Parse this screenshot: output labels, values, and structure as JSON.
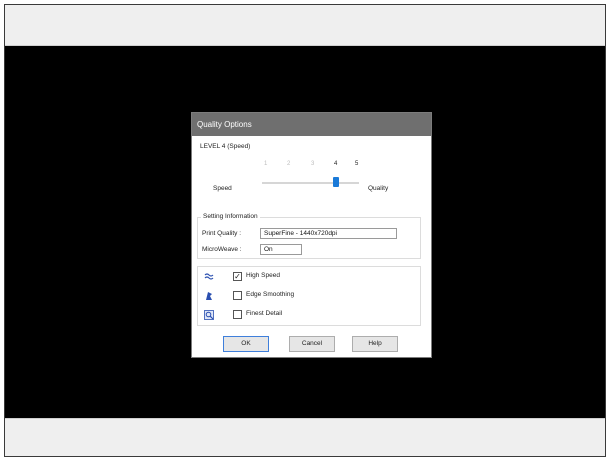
{
  "dialog": {
    "title": "Quality Options",
    "level_label": "LEVEL 4 (Speed)",
    "slider": {
      "ticks": [
        "1",
        "2",
        "3",
        "4",
        "5"
      ],
      "selected": 4,
      "left_label": "Speed",
      "right_label": "Quality",
      "accent_color": "#1a7ad8"
    },
    "setting_info": {
      "title": "Setting Information",
      "print_quality_label": "Print Quality :",
      "print_quality_value": "SuperFine - 1440x720dpi",
      "microweave_label": "MicroWeave :",
      "microweave_value": "On"
    },
    "options": [
      {
        "icon": "high-speed-icon",
        "label": "High Speed",
        "checked": true
      },
      {
        "icon": "edge-smoothing-icon",
        "label": "Edge Smoothing",
        "checked": false
      },
      {
        "icon": "finest-detail-icon",
        "label": "Finest Detail",
        "checked": false
      }
    ],
    "buttons": {
      "ok": "OK",
      "cancel": "Cancel",
      "help": "Help"
    }
  }
}
